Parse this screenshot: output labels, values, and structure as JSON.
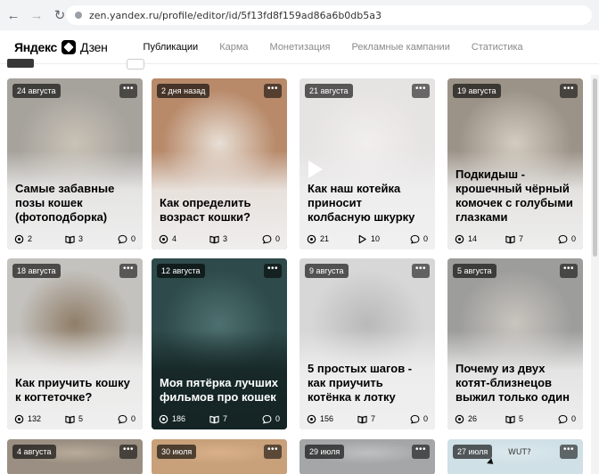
{
  "browser": {
    "url": "zen.yandex.ru/profile/editor/id/5f13fd8f159ad86a6b0db5a3"
  },
  "header": {
    "logo_yandex": "Яндекс",
    "logo_dzen": "Дзен",
    "tabs": [
      {
        "label": "Публикации",
        "active": true
      },
      {
        "label": "Карма",
        "active": false
      },
      {
        "label": "Монетизация",
        "active": false
      },
      {
        "label": "Рекламные кампании",
        "active": false
      },
      {
        "label": "Статистика",
        "active": false
      }
    ]
  },
  "cards": [
    {
      "date": "24 августа",
      "title": "Самые забавные позы кошек (фотоподборка)",
      "views": "2",
      "reads": "3",
      "comments": "0",
      "read_icon": "book",
      "theme": "light",
      "photo_top": "#a6a29c",
      "photo_mid": "#c9c2b6",
      "photo_bot": "#8d8576"
    },
    {
      "date": "2 дня назад",
      "title": "Как определить возраст кошки?",
      "views": "4",
      "reads": "3",
      "comments": "0",
      "read_icon": "book",
      "theme": "light",
      "photo_top": "#b88a6a",
      "photo_mid": "#e8dfd6",
      "photo_bot": "#7a6657"
    },
    {
      "date": "21 августа",
      "title": "Как наш котейка приносит колбасную шкурку",
      "views": "21",
      "reads": "10",
      "comments": "0",
      "read_icon": "play",
      "theme": "light",
      "photo_top": "#e6e3e3",
      "photo_mid": "#f1eeee",
      "photo_bot": "#b7a79f"
    },
    {
      "date": "19 августа",
      "title": "Подкидыш - крошечный чёрный комочек с голубыми глазками",
      "views": "14",
      "reads": "7",
      "comments": "0",
      "read_icon": "book",
      "theme": "light",
      "photo_top": "#9c9388",
      "photo_mid": "#d3ccc0",
      "photo_bot": "#8b8478"
    },
    {
      "date": "18 августа",
      "title": "Как приучить кошку к когтеточке?",
      "views": "132",
      "reads": "5",
      "comments": "0",
      "read_icon": "book",
      "theme": "light",
      "photo_top": "#c4c2be",
      "photo_mid": "#8f7d68",
      "photo_bot": "#6d6257"
    },
    {
      "date": "12 августа",
      "title": "Моя пятёрка лучших фильмов про кошек",
      "views": "186",
      "reads": "7",
      "comments": "0",
      "read_icon": "book",
      "theme": "dark",
      "photo_top": "#2e4a4a",
      "photo_mid": "#4e7070",
      "photo_bot": "#243636"
    },
    {
      "date": "9 августа",
      "title": "5 простых шагов - как приучить котёнка к лотку",
      "views": "156",
      "reads": "7",
      "comments": "0",
      "read_icon": "book",
      "theme": "light",
      "photo_top": "#d7d7d7",
      "photo_mid": "#b9b9b9",
      "photo_bot": "#9d9d9d"
    },
    {
      "date": "5 августа",
      "title": "Почему из двух котят-близнецов выжил только один",
      "views": "26",
      "reads": "5",
      "comments": "0",
      "read_icon": "book",
      "theme": "light",
      "photo_top": "#9d9d9b",
      "photo_mid": "#c9c5bf",
      "photo_bot": "#8e8a84"
    },
    {
      "date": "4 августа",
      "theme": "light",
      "photo_top": "#9a8f82",
      "photo_mid": "#b8ab9a",
      "photo_bot": "#9a8f82"
    },
    {
      "date": "30 июля",
      "theme": "light",
      "photo_top": "#c8a07a",
      "photo_mid": "#d9b08a",
      "photo_bot": "#c8a07a"
    },
    {
      "date": "29 июля",
      "theme": "light",
      "photo_top": "#a4a6a8",
      "photo_mid": "#bfc0c2",
      "photo_bot": "#a4a6a8"
    },
    {
      "date": "27 июля",
      "theme": "light",
      "photo_top": "#cfe0e6",
      "photo_mid": "#dce9ee",
      "photo_bot": "#cfe0e6",
      "overlay_text": "WUT?"
    }
  ],
  "icons": {
    "views": "eye-icon",
    "reads": "book-icon",
    "comments": "comment-icon",
    "more": "more-icon",
    "play": "play-icon"
  }
}
